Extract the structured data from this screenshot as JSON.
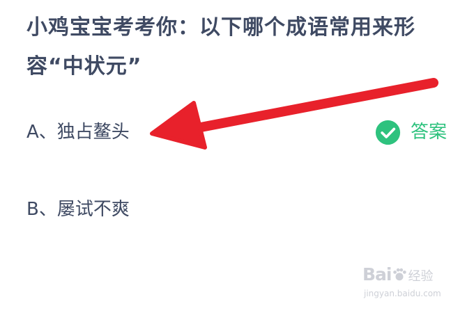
{
  "question": {
    "text": "小鸡宝宝考考你：以下哪个成语常用来形容“中状元”"
  },
  "options": [
    {
      "text": "A、独占鳌头"
    },
    {
      "text": "B、屡试不爽"
    }
  ],
  "answer": {
    "label": "答案",
    "icon": "check-circle-icon",
    "color": "#2ec27e"
  },
  "annotation": {
    "arrow_color": "#e8212b"
  },
  "watermark": {
    "logo_text": "Bai",
    "logo_text_2": "百",
    "logo_suffix": "经验",
    "url": "jingyan.baidu.com"
  }
}
